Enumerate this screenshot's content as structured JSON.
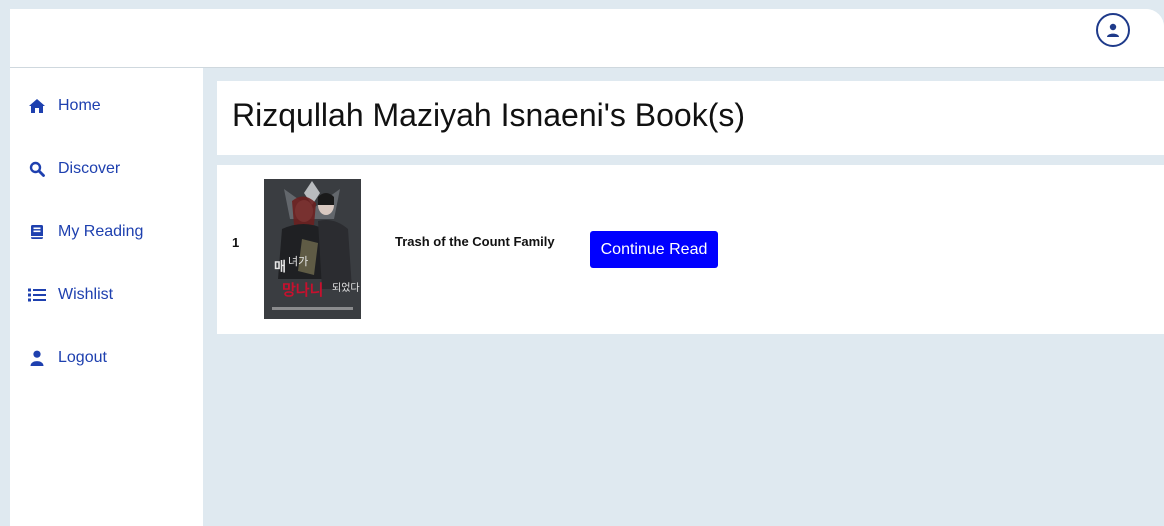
{
  "header": {
    "profile_icon": "user-circle-icon"
  },
  "sidebar": {
    "items": [
      {
        "label": "Home",
        "icon": "home-icon"
      },
      {
        "label": "Discover",
        "icon": "search-icon"
      },
      {
        "label": "My Reading",
        "icon": "book-icon"
      },
      {
        "label": "Wishlist",
        "icon": "list-icon"
      },
      {
        "label": "Logout",
        "icon": "user-icon"
      }
    ]
  },
  "main": {
    "title": "Rizqullah Maziyah Isnaeni's Book(s)",
    "books": [
      {
        "number": "1",
        "title": "Trash of the Count Family",
        "action_label": "Continue Read"
      }
    ]
  },
  "colors": {
    "accent": "#1e40af",
    "button": "#0000ff",
    "background": "#dfe9f0"
  }
}
